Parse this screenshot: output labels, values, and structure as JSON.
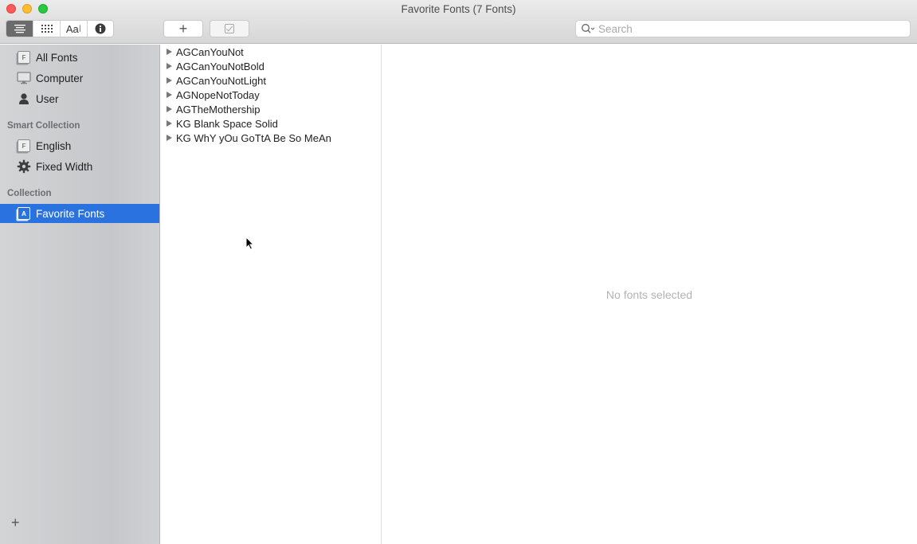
{
  "window": {
    "title": "Favorite Fonts (7 Fonts)"
  },
  "toolbar": {
    "view_modes": [
      {
        "name": "sample-list-view",
        "icon": "list-lines-icon",
        "active": true
      },
      {
        "name": "grid-view",
        "icon": "grid-dots-icon",
        "active": false
      },
      {
        "name": "custom-sample-view",
        "icon": "text-cursor-aa-icon",
        "label": "Aa",
        "active": false
      },
      {
        "name": "info-view",
        "icon": "info-icon",
        "active": false
      }
    ],
    "add_label": "+",
    "search": {
      "placeholder": "Search",
      "value": ""
    }
  },
  "sidebar": {
    "library_items": [
      {
        "label": "All Fonts",
        "icon": "font-book-icon"
      },
      {
        "label": "Computer",
        "icon": "computer-icon"
      },
      {
        "label": "User",
        "icon": "user-icon"
      }
    ],
    "smart_collection_header": "Smart Collection",
    "smart_collections": [
      {
        "label": "English",
        "icon": "font-book-icon"
      },
      {
        "label": "Fixed Width",
        "icon": "gear-icon"
      }
    ],
    "collection_header": "Collection",
    "collections": [
      {
        "label": "Favorite Fonts",
        "icon": "collection-icon",
        "selected": true
      }
    ],
    "add_label": "+"
  },
  "font_list": [
    "AGCanYouNot",
    "AGCanYouNotBold",
    "AGCanYouNotLight",
    "AGNopeNotToday",
    "AGTheMothership",
    "KG Blank Space Solid",
    "KG WhY yOu GoTtA Be So MeAn"
  ],
  "preview": {
    "empty_message": "No fonts selected"
  },
  "colors": {
    "selection": "#2a72e0",
    "close": "#fd5b57",
    "minimize": "#febc2e",
    "maximize": "#29c840"
  }
}
